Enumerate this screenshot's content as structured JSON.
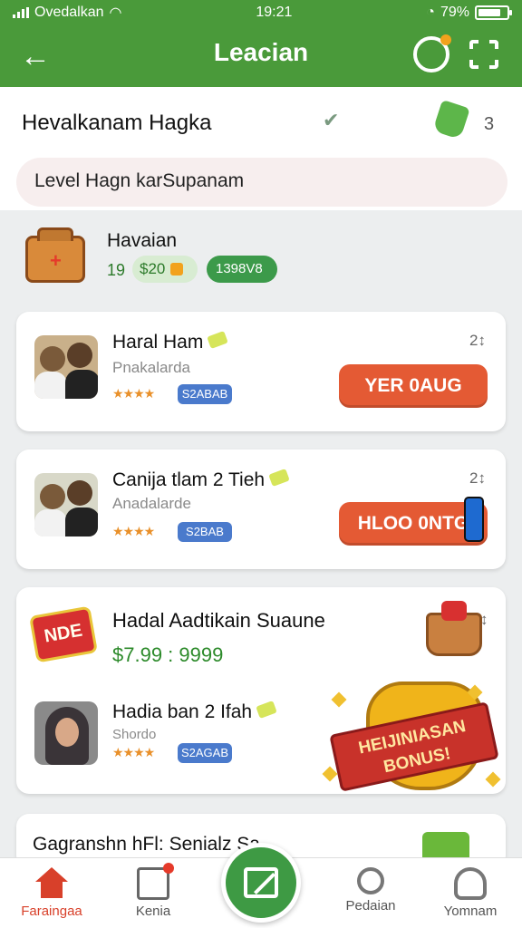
{
  "status_bar": {
    "carrier": "Ovedalkan",
    "time": "19:21",
    "battery": "79%"
  },
  "app_bar": {
    "title": "Leacian",
    "icons": [
      "arrow-left-icon",
      "refresh-badge-icon",
      "scan-icon"
    ]
  },
  "header": {
    "heading": "Hevalkanam Hagka",
    "count": "3",
    "level_text": "Level Hagn karSupanam"
  },
  "wallet": {
    "name": "Havaian",
    "points": "19",
    "balance": "$20",
    "code": "1398V8"
  },
  "offers": [
    {
      "title": "Haral Ham",
      "subtitle": "Pnakalarda",
      "badge": "S2ABAB",
      "rank": "2↕",
      "button": "YER 0AUG"
    },
    {
      "title": "Canija tlam 2 Tieh",
      "subtitle": "Anadalarde",
      "badge": "S2BAB",
      "rank": "2↕",
      "button": "HLOO 0NTG"
    }
  ],
  "promo": {
    "title": "Hadal Aadtikain Suaune",
    "price": "$7.99 : 9999",
    "sale_label": "NDE",
    "sub_title": "Hadia ban 2 Ifah",
    "sub_subtitle": "Shordo",
    "badge": "S2AGAB",
    "bonus_text": "HEIJINIASAN BONUS!"
  },
  "last_card": {
    "title": "Gagranshn hFl: Senialz Sa..."
  },
  "bottom_nav": [
    {
      "label": "Faraingaa",
      "icon": "home-icon",
      "active": true
    },
    {
      "label": "Kenia",
      "icon": "document-icon",
      "active": false
    },
    {
      "label": "",
      "icon": "compose-icon",
      "active": false
    },
    {
      "label": "Pedaian",
      "icon": "search-icon",
      "active": false
    },
    {
      "label": "Yomnam",
      "icon": "user-icon",
      "active": false
    }
  ],
  "colors": {
    "primary": "#4a9a3a",
    "cta": "#e45a34",
    "badge": "#4a7acc",
    "accent_active": "#d8402a"
  }
}
